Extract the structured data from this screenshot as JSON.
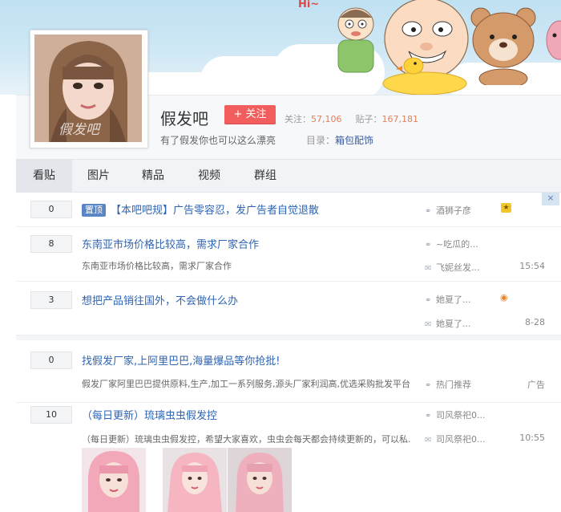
{
  "banner": {
    "greeting": "Hi~"
  },
  "forum": {
    "title": "假发吧",
    "follow_label": "+ 关注",
    "follow_prefix": "关注：",
    "follow_count": "57,106",
    "posts_prefix": "贴子：",
    "posts_count": "167,181",
    "slogan": "有了假发你也可以这么漂亮",
    "catalog_prefix": "目录：",
    "catalog_link": "箱包配饰",
    "avatar_watermark": "假发吧"
  },
  "nav": {
    "tabs": [
      "看贴",
      "图片",
      "精品",
      "视频",
      "群组"
    ],
    "active": 0
  },
  "corner_close": "×",
  "posts": [
    {
      "count": "0",
      "tag": "置顶",
      "title": "【本吧吧规】广告零容忍，发广告者自觉退散",
      "author": "酒狮子彦",
      "badge_icon": "grade-icon"
    },
    {
      "count": "8",
      "title": "东南亚市场价格比较高，需求厂家合作",
      "abstract": "东南亚市场价格比较高，需求厂家合作",
      "author": "~吃瓜的...",
      "replier": "飞妮丝发...",
      "time": "15:54"
    },
    {
      "count": "3",
      "title": "想把产品销往国外，不会做什么办",
      "author": "她夏了...",
      "replier": "她夏了...",
      "time": "8-28",
      "badge_icon": "emoji-icon"
    },
    {
      "count": "0",
      "title": "找假发厂家,上阿里巴巴,海量爆品等你抢批!",
      "abstract": "假发厂家阿里巴巴提供原料,生产,加工一系列服务,源头厂家利润高,优选采购批发平台...",
      "author": "热门推荐",
      "time": "广告"
    },
    {
      "count": "10",
      "title": "（每日更新）琉璃虫虫假发控",
      "abstract": "（每日更新）琉璃虫虫假发控，希望大家喜欢，虫虫会每天都会持续更新的，可以私...",
      "author": "司风祭祀0...",
      "replier": "司风祭祀0...",
      "time": "10:55"
    }
  ]
}
